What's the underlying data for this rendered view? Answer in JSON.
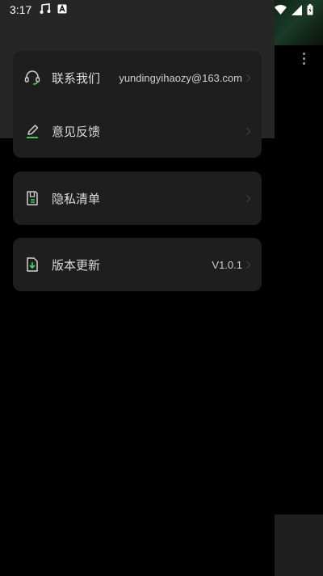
{
  "status_bar": {
    "time": "3:17",
    "left_icons": [
      "music-note-icon",
      "app-a-icon"
    ],
    "right_icons": [
      "wifi-icon",
      "signal-icon",
      "battery-icon"
    ]
  },
  "colors": {
    "background": "#000000",
    "card": "#1e1e1e",
    "header": "#262626",
    "accent": "#3ddc5a",
    "text": "#dcdcdc"
  },
  "settings": {
    "contact": {
      "label": "联系我们",
      "value": "yundingyihaozy@163.com",
      "icon": "headset-icon"
    },
    "feedback": {
      "label": "意见反馈",
      "icon": "pencil-icon"
    },
    "privacy": {
      "label": "隐私清单",
      "icon": "document-list-icon"
    },
    "version": {
      "label": "版本更新",
      "value": "V1.0.1",
      "icon": "download-file-icon"
    }
  }
}
